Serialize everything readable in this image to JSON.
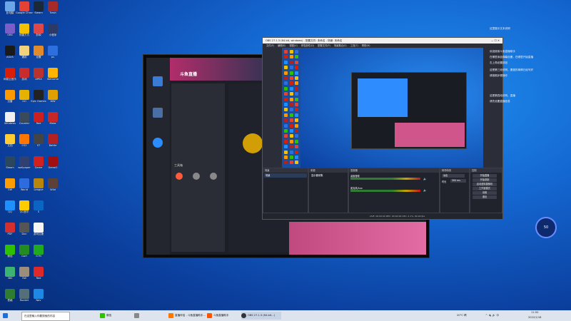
{
  "desktop": {
    "icons": [
      {
        "label": "此电脑",
        "color": "#6ba7e8"
      },
      {
        "label": "Google Chrome",
        "color": "#e34234"
      },
      {
        "label": "Steam",
        "color": "#1b2838"
      },
      {
        "label": "Trash",
        "color": "#a52a2a"
      },
      {
        "label": "OBS",
        "color": "#7a5dc7"
      },
      {
        "label": "快捷方式",
        "color": "#f2c200"
      },
      {
        "label": "剪映",
        "color": "#e04848"
      },
      {
        "label": "小程序",
        "color": "#2b3a67"
      },
      {
        "label": "ASUS",
        "color": "#1a1a1a"
      },
      {
        "label": "通用",
        "color": "#f2d27a"
      },
      {
        "label": "设置",
        "color": "#e28a2a"
      },
      {
        "label": "ps",
        "color": "#2e6fe0"
      },
      {
        "label": "网易云音乐",
        "color": "#d81e06"
      },
      {
        "label": "游戏",
        "color": "#c92c2c"
      },
      {
        "label": "APEX",
        "color": "#b8322e"
      },
      {
        "label": "WeGame",
        "color": "#ffb400"
      },
      {
        "label": "迅雷",
        "color": "#ff9900"
      },
      {
        "label": "GO",
        "color": "#e7b100"
      },
      {
        "label": "Epic Games",
        "color": "#222222"
      },
      {
        "label": "WW",
        "color": "#e0a000"
      },
      {
        "label": "Windows",
        "color": "#f0f0f0"
      },
      {
        "label": "Counter",
        "color": "#3a4a5a"
      },
      {
        "label": "Red",
        "color": "#cc2020"
      },
      {
        "label": "Meta",
        "color": "#c62828"
      },
      {
        "label": "文档",
        "color": "#ffcc33"
      },
      {
        "label": "CS2",
        "color": "#ff7700"
      },
      {
        "label": "ST",
        "color": "#444"
      },
      {
        "label": "Battle",
        "color": "#b22222"
      },
      {
        "label": "Steam",
        "color": "#2a475e"
      },
      {
        "label": "wallpaper",
        "color": "#304070"
      },
      {
        "label": "Game",
        "color": "#d02020"
      },
      {
        "label": "Game2",
        "color": "#a01010"
      },
      {
        "label": "OW",
        "color": "#ff9c00"
      },
      {
        "label": "World",
        "color": "#2d6cdf"
      },
      {
        "label": "League",
        "color": "#b8860b"
      },
      {
        "label": "Wild",
        "color": "#5d4037"
      },
      {
        "label": "QQ",
        "color": "#1e90ff"
      },
      {
        "label": "QQ音乐",
        "color": "#ffcc00"
      },
      {
        "label": "S",
        "color": "#0a66c2"
      },
      {
        "label": "",
        "color": "transparent"
      },
      {
        "label": "PDF",
        "color": "#d32f2f"
      },
      {
        "label": "Doc",
        "color": "#555"
      },
      {
        "label": "游戏加速",
        "color": "#f5f5f5"
      },
      {
        "label": "",
        "color": "transparent"
      },
      {
        "label": "微信",
        "color": "#2dc100"
      },
      {
        "label": "GoH",
        "color": "#228b22"
      },
      {
        "label": "STM",
        "color": "#1faa1f"
      },
      {
        "label": "",
        "color": "transparent"
      },
      {
        "label": "360",
        "color": "#3cb371"
      },
      {
        "label": "SW",
        "color": "#9c8e7a"
      },
      {
        "label": "Red",
        "color": "#e02828"
      },
      {
        "label": "",
        "color": "transparent"
      },
      {
        "label": "表格",
        "color": "#2e7d32"
      },
      {
        "label": "Rocket",
        "color": "#546e7a"
      },
      {
        "label": "Nav",
        "color": "#1e88e5"
      },
      {
        "label": "",
        "color": "transparent"
      }
    ],
    "notes": [
      "这里展示文本说明",
      "欢迎使用斗鱼直播助手",
      "在哪里添加弹幕设置，在哪里开始直播",
      "右上角设置按钮",
      "这是第三段说明，要做的事情已经写好",
      "请按照步骤操作",
      "这是第四段说明，直播",
      "请先设置直播信息"
    ],
    "widget_value": "50"
  },
  "obs": {
    "title": "OBS 27.1.3 (64-bit, windows) - 配置文件: 未命名 - 场景: 未命名",
    "menu": [
      "文件(F)",
      "编辑(E)",
      "视图(V)",
      "停靠部件(D)",
      "配置文件(P)",
      "场景集合(S)",
      "工具(T)",
      "帮助(H)"
    ],
    "docks": {
      "scenes": "场景",
      "sources": "来源",
      "mixer": "混音器",
      "transitions": "转场特效",
      "controls": "控制"
    },
    "scene_item": "场景",
    "source_item": "显示器采集",
    "mixer_tracks": [
      "桌面音频",
      "麦克风/Aux"
    ],
    "transition": "淡出",
    "duration_label": "时长",
    "duration": "300 ms",
    "controls": [
      "开始直播",
      "开始录制",
      "启动虚拟摄像机",
      "工作室模式",
      "设置",
      "退出"
    ],
    "status": "LIVE: 00:00:00   REC: 00:00:00   CPU: 2.1%, 60.00 fps"
  },
  "bg_app": {
    "title": "斗鱼直播",
    "tabs": [
      "主播中心",
      "直播设置"
    ],
    "tools_label": "工具箱"
  },
  "taskbar": {
    "search": "在这里输入你要搜索的内容",
    "items": [
      "微信",
      "",
      "直播伴侣 - 斗鱼直播助手...",
      "斗鱼直播助手",
      "OBS 27.1.3 (64-bit...)"
    ],
    "weather": "20°C 晴",
    "time": "11:50",
    "date": "2022/1/18"
  }
}
